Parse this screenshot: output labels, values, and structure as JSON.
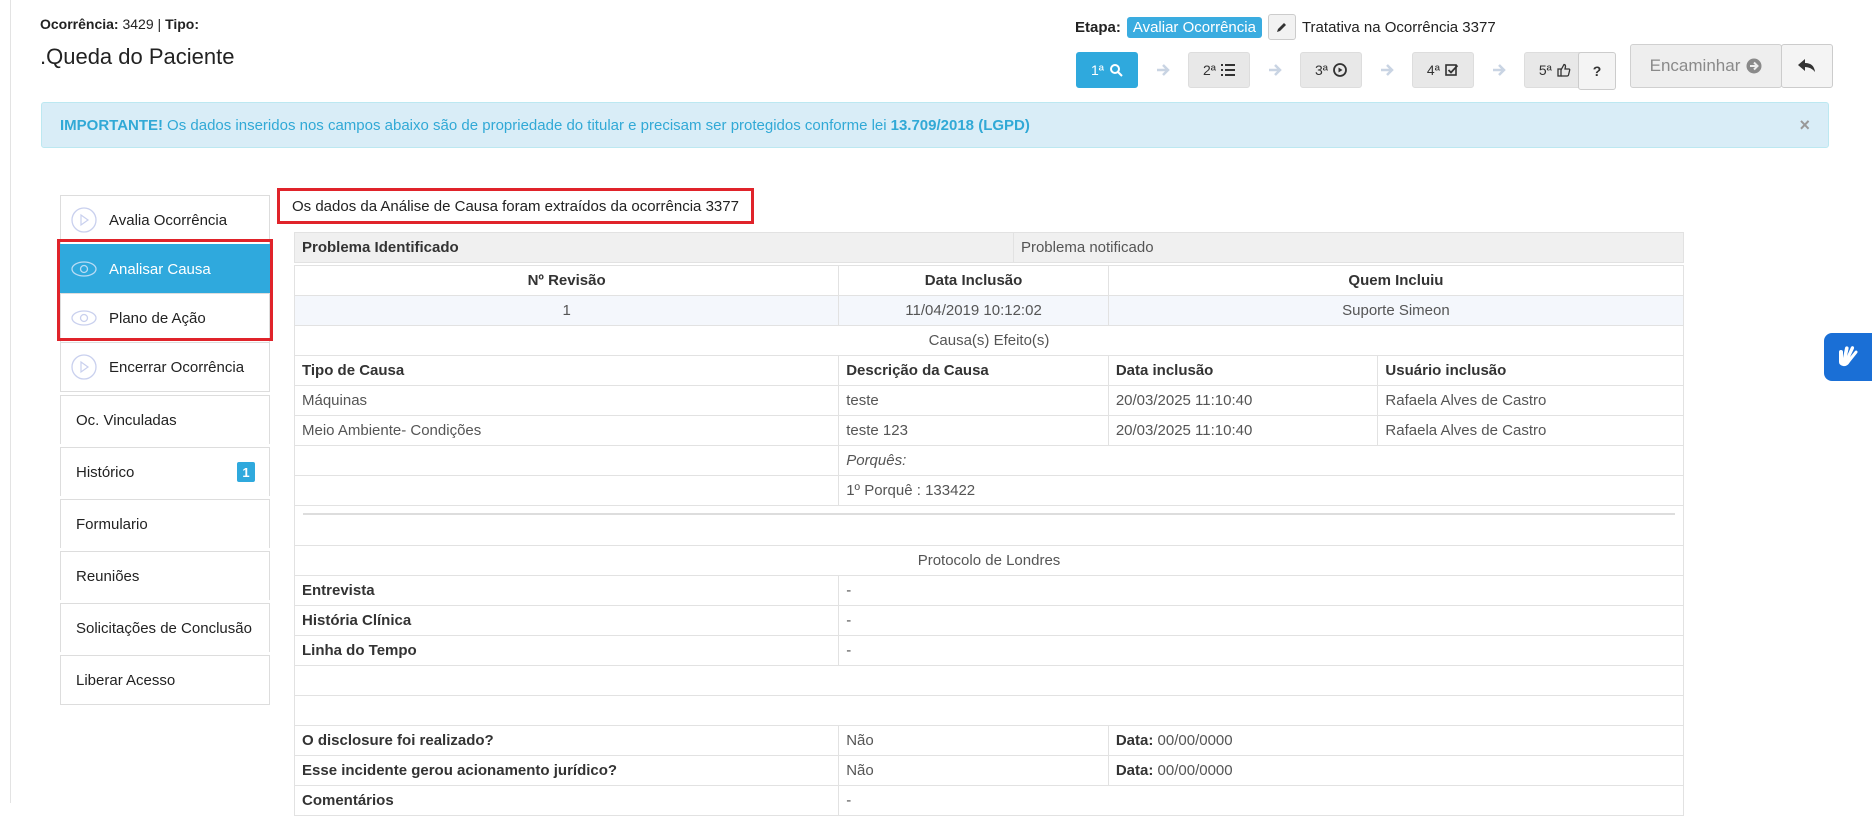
{
  "header": {
    "ocorrencia_label": "Ocorrência:",
    "ocorrencia_num": "3429",
    "sep": "|",
    "tipo_label": "Tipo:",
    "title": ".Queda do Paciente",
    "etapa_label": "Etapa:",
    "etapa_value": "Avaliar Ocorrência",
    "tratativa": "Tratativa na Ocorrência 3377"
  },
  "steps": [
    {
      "label": "1ª",
      "icon": "search-icon"
    },
    {
      "label": "2ª",
      "icon": "list-icon"
    },
    {
      "label": "3ª",
      "icon": "play-circle-icon"
    },
    {
      "label": "4ª",
      "icon": "check-square-icon"
    },
    {
      "label": "5ª",
      "icon": "thumbs-up-icon"
    }
  ],
  "help_label": "?",
  "encaminhar_label": "Encaminhar",
  "alert": {
    "important": "IMPORTANTE!",
    "text": "Os dados inseridos nos campos abaixo são de propriedade do titular e precisam ser protegidos conforme lei",
    "law": "13.709/2018 (LGPD)",
    "close": "×"
  },
  "sidebar": {
    "step_items": [
      {
        "label": "Avalia Ocorrência",
        "icon": "play-circle-icon"
      },
      {
        "label": "Analisar Causa",
        "icon": "eye-icon"
      },
      {
        "label": "Plano de Ação",
        "icon": "eye-icon"
      },
      {
        "label": "Encerrar Ocorrência",
        "icon": "play-circle-icon"
      }
    ],
    "items": [
      {
        "label": "Oc. Vinculadas"
      },
      {
        "label": "Histórico",
        "badge": "1"
      },
      {
        "label": "Formulario"
      },
      {
        "label": "Reuniões"
      },
      {
        "label": "Solicitações de Conclusão"
      },
      {
        "label": "Liberar Acesso"
      }
    ]
  },
  "notice": "Os dados da Análise de Causa foram extraídos da ocorrência 3377",
  "table": {
    "problema_label": "Problema Identificado",
    "problema_value": "Problema notificado",
    "rev_headers": [
      "Nº Revisão",
      "Data Inclusão",
      "Quem Incluiu"
    ],
    "rev_row": [
      "1",
      "11/04/2019 10:12:02",
      "Suporte Simeon"
    ],
    "causas_title": "Causa(s) Efeito(s)",
    "causa_headers": [
      "Tipo de Causa",
      "Descrição da Causa",
      "Data inclusão",
      "Usuário inclusão"
    ],
    "causa_rows": [
      [
        "Máquinas",
        "teste",
        "20/03/2025 11:10:40",
        "Rafaela Alves de Castro"
      ],
      [
        "Meio Ambiente- Condições",
        "teste 123",
        "20/03/2025 11:10:40",
        "Rafaela Alves de Castro"
      ]
    ],
    "porques_label": "Porquês:",
    "porque_1": "1º Porquê : 133422",
    "protocolo_title": "Protocolo de Londres",
    "protocolo_rows": [
      [
        "Entrevista",
        "-"
      ],
      [
        "História Clínica",
        "-"
      ],
      [
        "Linha do Tempo",
        "-"
      ]
    ],
    "disclosure_rows": [
      [
        "O disclosure foi realizado?",
        "Não",
        "Data:",
        "00/00/0000"
      ],
      [
        "Esse incidente gerou acionamento jurídico?",
        "Não",
        "Data:",
        "00/00/0000"
      ]
    ],
    "comentarios_label": "Comentários",
    "comentarios_value": "-"
  },
  "colors": {
    "accent": "#2fa9dd",
    "highlight": "#e0232a",
    "alert_bg": "#d9edf7"
  }
}
